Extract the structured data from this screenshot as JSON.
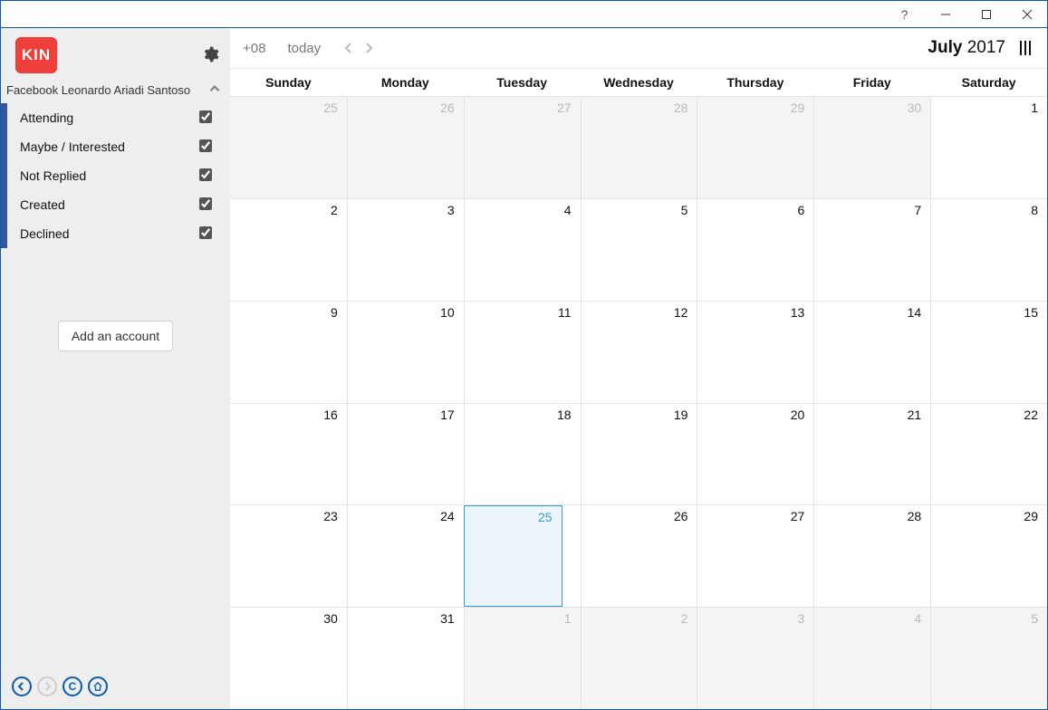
{
  "window": {
    "help": "?",
    "minimize": "—",
    "maximize": "▢",
    "close": "✕"
  },
  "sidebar": {
    "logo": "KIN",
    "account_label": "Facebook Leonardo Ariadi Santoso",
    "filters": [
      {
        "label": "Attending",
        "checked": true
      },
      {
        "label": "Maybe / Interested",
        "checked": true
      },
      {
        "label": "Not Replied",
        "checked": true
      },
      {
        "label": "Created",
        "checked": true
      },
      {
        "label": "Declined",
        "checked": true
      }
    ],
    "add_account_label": "Add an account"
  },
  "topbar": {
    "timezone": "+08",
    "today_label": "today",
    "month": "July",
    "year": "2017"
  },
  "days_of_week": [
    "Sunday",
    "Monday",
    "Tuesday",
    "Wednesday",
    "Thursday",
    "Friday",
    "Saturday"
  ],
  "grid": [
    [
      {
        "n": "25",
        "out": true,
        "shade": true
      },
      {
        "n": "26",
        "out": true,
        "shade": true
      },
      {
        "n": "27",
        "out": true,
        "shade": true
      },
      {
        "n": "28",
        "out": true,
        "shade": true
      },
      {
        "n": "29",
        "out": true,
        "shade": true
      },
      {
        "n": "30",
        "out": true,
        "shade": true
      },
      {
        "n": "1"
      }
    ],
    [
      {
        "n": "2"
      },
      {
        "n": "3"
      },
      {
        "n": "4"
      },
      {
        "n": "5"
      },
      {
        "n": "6"
      },
      {
        "n": "7"
      },
      {
        "n": "8"
      }
    ],
    [
      {
        "n": "9"
      },
      {
        "n": "10"
      },
      {
        "n": "11"
      },
      {
        "n": "12"
      },
      {
        "n": "13"
      },
      {
        "n": "14"
      },
      {
        "n": "15"
      }
    ],
    [
      {
        "n": "16"
      },
      {
        "n": "17"
      },
      {
        "n": "18"
      },
      {
        "n": "19"
      },
      {
        "n": "20"
      },
      {
        "n": "21"
      },
      {
        "n": "22"
      }
    ],
    [
      {
        "n": "23"
      },
      {
        "n": "24"
      },
      {
        "n": "25",
        "today": true
      },
      {
        "n": "26"
      },
      {
        "n": "27"
      },
      {
        "n": "28"
      },
      {
        "n": "29"
      }
    ],
    [
      {
        "n": "30"
      },
      {
        "n": "31"
      },
      {
        "n": "1",
        "out": true,
        "shade": true
      },
      {
        "n": "2",
        "out": true,
        "shade": true
      },
      {
        "n": "3",
        "out": true,
        "shade": true
      },
      {
        "n": "4",
        "out": true,
        "shade": true
      },
      {
        "n": "5",
        "out": true,
        "shade": true
      }
    ]
  ]
}
